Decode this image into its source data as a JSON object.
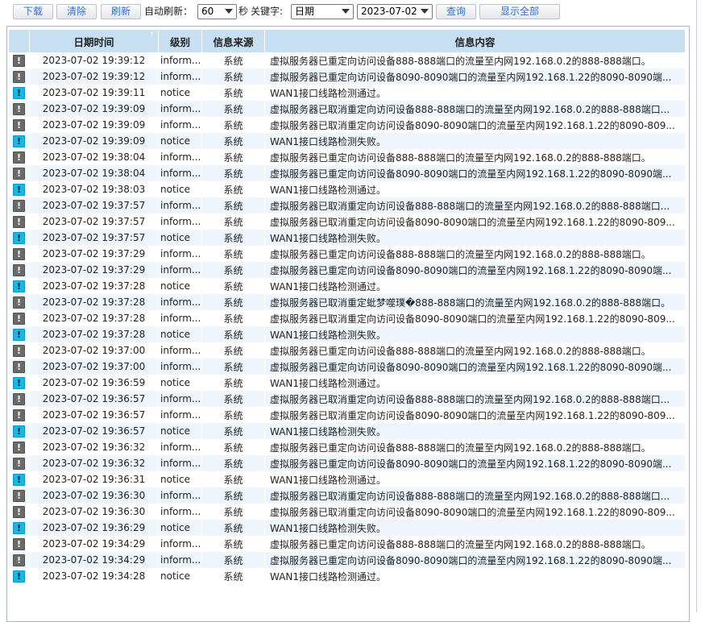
{
  "toolbar": {
    "download_label": "下载",
    "clear_label": "清除",
    "refresh_label": "刷新",
    "auto_refresh_label": "自动刷新：",
    "auto_refresh_value": "60",
    "seconds_label": "秒",
    "keyword_label": "关键字:",
    "keyword_field_value": "日期",
    "date_value": "2023-07-02",
    "query_label": "查询",
    "show_all_label": "显示全部"
  },
  "table": {
    "headers": [
      "",
      "日期时间",
      "级别",
      "信息来源",
      "信息内容"
    ],
    "rows": [
      {
        "icon": "info",
        "time": "2023-07-02 19:39:12",
        "level": "inform...",
        "source": "系统",
        "message": "虚拟服务器已重定向访问设备888-888端口的流量至内网192.168.0.2的888-888端口。"
      },
      {
        "icon": "info",
        "time": "2023-07-02 19:39:12",
        "level": "inform...",
        "source": "系统",
        "message": "虚拟服务器已重定向访问设备8090-8090端口的流量至内网192.168.1.22的8090-8090端..."
      },
      {
        "icon": "notice",
        "time": "2023-07-02 19:39:11",
        "level": "notice",
        "source": "系统",
        "message": "WAN1接口线路检测通过。"
      },
      {
        "icon": "info",
        "time": "2023-07-02 19:39:09",
        "level": "inform...",
        "source": "系统",
        "message": "虚拟服务器已取消重定向访问设备888-888端口的流量至内网192.168.0.2的888-888端口..."
      },
      {
        "icon": "info",
        "time": "2023-07-02 19:39:09",
        "level": "inform...",
        "source": "系统",
        "message": "虚拟服务器已取消重定向访问设备8090-8090端口的流量至内网192.168.1.22的8090-809..."
      },
      {
        "icon": "notice",
        "time": "2023-07-02 19:39:09",
        "level": "notice",
        "source": "系统",
        "message": "WAN1接口线路检测失败。"
      },
      {
        "icon": "info",
        "time": "2023-07-02 19:38:04",
        "level": "inform...",
        "source": "系统",
        "message": "虚拟服务器已重定向访问设备888-888端口的流量至内网192.168.0.2的888-888端口。"
      },
      {
        "icon": "info",
        "time": "2023-07-02 19:38:04",
        "level": "inform...",
        "source": "系统",
        "message": "虚拟服务器已重定向访问设备8090-8090端口的流量至内网192.168.1.22的8090-8090端..."
      },
      {
        "icon": "notice",
        "time": "2023-07-02 19:38:03",
        "level": "notice",
        "source": "系统",
        "message": "WAN1接口线路检测通过。"
      },
      {
        "icon": "info",
        "time": "2023-07-02 19:37:57",
        "level": "inform...",
        "source": "系统",
        "message": "虚拟服务器已取消重定向访问设备888-888端口的流量至内网192.168.0.2的888-888端口..."
      },
      {
        "icon": "info",
        "time": "2023-07-02 19:37:57",
        "level": "inform...",
        "source": "系统",
        "message": "虚拟服务器已取消重定向访问设备8090-8090端口的流量至内网192.168.1.22的8090-809..."
      },
      {
        "icon": "notice",
        "time": "2023-07-02 19:37:57",
        "level": "notice",
        "source": "系统",
        "message": "WAN1接口线路检测失败。"
      },
      {
        "icon": "info",
        "time": "2023-07-02 19:37:29",
        "level": "inform...",
        "source": "系统",
        "message": "虚拟服务器已重定向访问设备888-888端口的流量至内网192.168.0.2的888-888端口。"
      },
      {
        "icon": "info",
        "time": "2023-07-02 19:37:29",
        "level": "inform...",
        "source": "系统",
        "message": "虚拟服务器已重定向访问设备8090-8090端口的流量至内网192.168.1.22的8090-8090端..."
      },
      {
        "icon": "notice",
        "time": "2023-07-02 19:37:28",
        "level": "notice",
        "source": "系统",
        "message": "WAN1接口线路检测通过。"
      },
      {
        "icon": "info",
        "time": "2023-07-02 19:37:28",
        "level": "inform...",
        "source": "系统",
        "message": "虚拟服务器已取消重定蚍梦噬璞�888-888端口的流量至内网192.168.0.2的888-888端口。"
      },
      {
        "icon": "info",
        "time": "2023-07-02 19:37:28",
        "level": "inform...",
        "source": "系统",
        "message": "虚拟服务器已取消重定向访问设备8090-8090端口的流量至内网192.168.1.22的8090-809..."
      },
      {
        "icon": "notice",
        "time": "2023-07-02 19:37:28",
        "level": "notice",
        "source": "系统",
        "message": "WAN1接口线路检测失败。"
      },
      {
        "icon": "info",
        "time": "2023-07-02 19:37:00",
        "level": "inform...",
        "source": "系统",
        "message": "虚拟服务器已重定向访问设备888-888端口的流量至内网192.168.0.2的888-888端口。"
      },
      {
        "icon": "info",
        "time": "2023-07-02 19:37:00",
        "level": "inform...",
        "source": "系统",
        "message": "虚拟服务器已重定向访问设备8090-8090端口的流量至内网192.168.1.22的8090-8090端..."
      },
      {
        "icon": "notice",
        "time": "2023-07-02 19:36:59",
        "level": "notice",
        "source": "系统",
        "message": "WAN1接口线路检测通过。"
      },
      {
        "icon": "info",
        "time": "2023-07-02 19:36:57",
        "level": "inform...",
        "source": "系统",
        "message": "虚拟服务器已取消重定向访问设备888-888端口的流量至内网192.168.0.2的888-888端口..."
      },
      {
        "icon": "info",
        "time": "2023-07-02 19:36:57",
        "level": "inform...",
        "source": "系统",
        "message": "虚拟服务器已取消重定向访问设备8090-8090端口的流量至内网192.168.1.22的8090-809..."
      },
      {
        "icon": "notice",
        "time": "2023-07-02 19:36:57",
        "level": "notice",
        "source": "系统",
        "message": "WAN1接口线路检测失败。"
      },
      {
        "icon": "info",
        "time": "2023-07-02 19:36:32",
        "level": "inform...",
        "source": "系统",
        "message": "虚拟服务器已重定向访问设备888-888端口的流量至内网192.168.0.2的888-888端口。"
      },
      {
        "icon": "info",
        "time": "2023-07-02 19:36:32",
        "level": "inform...",
        "source": "系统",
        "message": "虚拟服务器已重定向访问设备8090-8090端口的流量至内网192.168.1.22的8090-8090端..."
      },
      {
        "icon": "notice",
        "time": "2023-07-02 19:36:31",
        "level": "notice",
        "source": "系统",
        "message": "WAN1接口线路检测通过。"
      },
      {
        "icon": "info",
        "time": "2023-07-02 19:36:30",
        "level": "inform...",
        "source": "系统",
        "message": "虚拟服务器已取消重定向访问设备888-888端口的流量至内网192.168.0.2的888-888端口..."
      },
      {
        "icon": "info",
        "time": "2023-07-02 19:36:30",
        "level": "inform...",
        "source": "系统",
        "message": "虚拟服务器已取消重定向访问设备8090-8090端口的流量至内网192.168.1.22的8090-809..."
      },
      {
        "icon": "notice",
        "time": "2023-07-02 19:36:29",
        "level": "notice",
        "source": "系统",
        "message": "WAN1接口线路检测失败。"
      },
      {
        "icon": "info",
        "time": "2023-07-02 19:34:29",
        "level": "inform...",
        "source": "系统",
        "message": "虚拟服务器已重定向访问设备888-888端口的流量至内网192.168.0.2的888-888端口。"
      },
      {
        "icon": "info",
        "time": "2023-07-02 19:34:29",
        "level": "inform...",
        "source": "系统",
        "message": "虚拟服务器已重定向访问设备8090-8090端口的流量至内网192.168.1.22的8090-8090端..."
      },
      {
        "icon": "notice",
        "time": "2023-07-02 19:34:28",
        "level": "notice",
        "source": "系统",
        "message": "WAN1接口线路检测通过。"
      }
    ]
  },
  "icons": {
    "info": "exclamation-gray-icon",
    "notice": "exclamation-cyan-icon"
  },
  "colors": {
    "header_bg": "#c6dff3",
    "row_alt_bg": "#eef5fc",
    "notice_icon": "#17b8e6",
    "info_icon": "#6b6b6b",
    "button_text": "#2f6fd3"
  }
}
